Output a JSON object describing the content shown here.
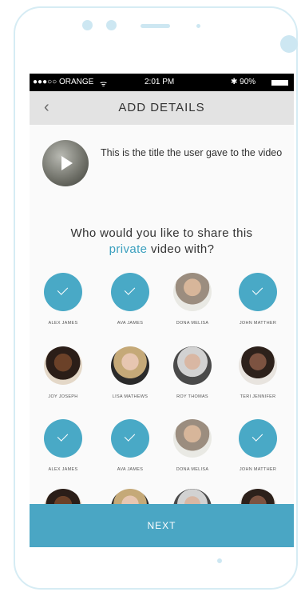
{
  "status": {
    "carrier": "●●●○○ ORANGE",
    "wifi": "ᯤ",
    "time": "2:01 PM",
    "battery": "✱ 90%"
  },
  "header": {
    "back": "‹",
    "title": "ADD DETAILS"
  },
  "video": {
    "title": "This is the title the user gave to the video"
  },
  "question": {
    "line1": "Who would you like to share this",
    "accent": "private",
    "line2_rest": " video with?"
  },
  "people": [
    {
      "name": "ALEX JAMES",
      "selected": true
    },
    {
      "name": "AVA JAMES",
      "selected": true
    },
    {
      "name": "DONA MELISA",
      "selected": false
    },
    {
      "name": "JOHN MATTHER",
      "selected": true
    },
    {
      "name": "JOY JOSEPH",
      "selected": false
    },
    {
      "name": "LISA MATHEWS",
      "selected": false
    },
    {
      "name": "ROY THOMAS",
      "selected": false
    },
    {
      "name": "TERI JENNIFER",
      "selected": false
    },
    {
      "name": "ALEX JAMES",
      "selected": true
    },
    {
      "name": "AVA JAMES",
      "selected": true
    },
    {
      "name": "DONA MELISA",
      "selected": false
    },
    {
      "name": "JOHN MATTHER",
      "selected": true
    }
  ],
  "footer": {
    "next": "NEXT"
  }
}
